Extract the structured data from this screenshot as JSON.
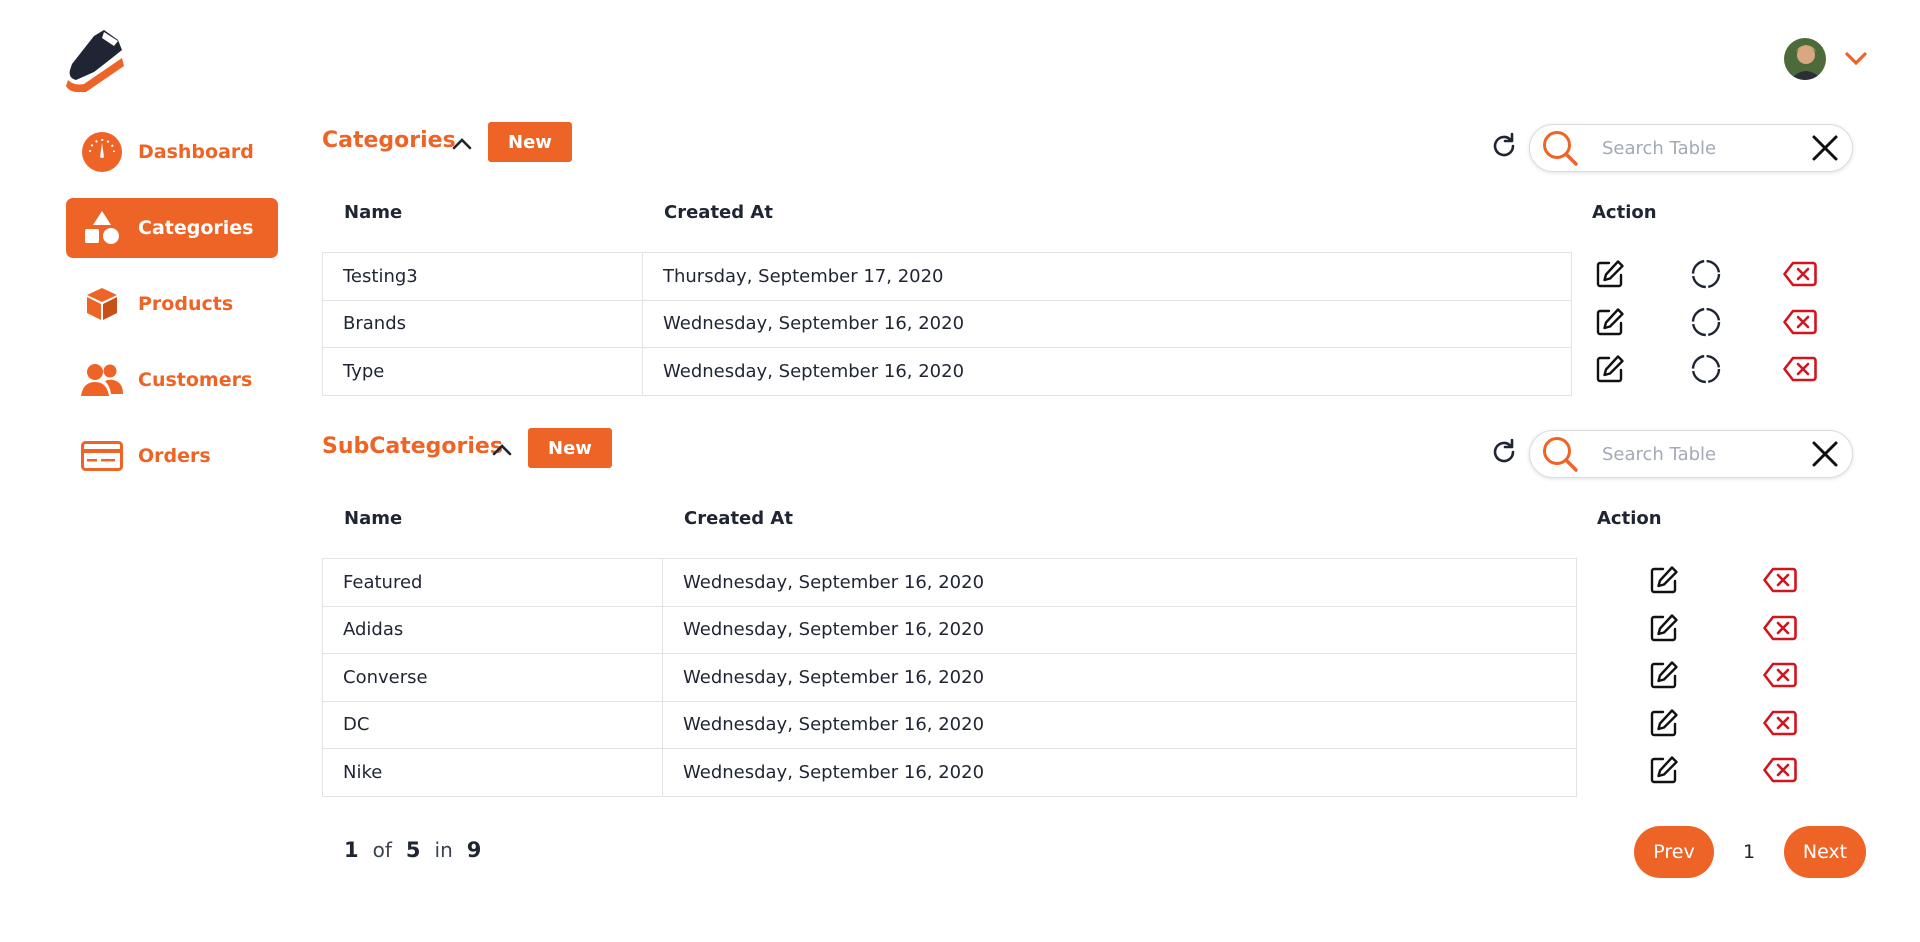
{
  "colors": {
    "accent": "#ee6427",
    "danger": "#d2141e",
    "text": "#1f2533"
  },
  "user": {
    "avatar_icon": "user-avatar",
    "menu_icon": "chevron-down-icon"
  },
  "sidebar": {
    "items": [
      {
        "label": "Dashboard",
        "icon": "gauge-icon",
        "active": false
      },
      {
        "label": "Categories",
        "icon": "shapes-icon",
        "active": true
      },
      {
        "label": "Products",
        "icon": "box-icon",
        "active": false
      },
      {
        "label": "Customers",
        "icon": "users-icon",
        "active": false
      },
      {
        "label": "Orders",
        "icon": "credit-card-icon",
        "active": false
      }
    ]
  },
  "categories": {
    "title": "Categories",
    "new_label": "New",
    "search_placeholder": "Search Table",
    "columns": {
      "name": "Name",
      "created": "Created At",
      "action": "Action"
    },
    "rows": [
      {
        "name": "Testing3",
        "created": "Thursday, September 17, 2020"
      },
      {
        "name": "Brands",
        "created": "Wednesday, September 16, 2020"
      },
      {
        "name": "Type",
        "created": "Wednesday, September 16, 2020"
      }
    ]
  },
  "subcategories": {
    "title": "SubCategories",
    "new_label": "New",
    "search_placeholder": "Search Table",
    "columns": {
      "name": "Name",
      "created": "Created At",
      "action": "Action"
    },
    "rows": [
      {
        "name": "Featured",
        "created": "Wednesday, September 16, 2020"
      },
      {
        "name": "Adidas",
        "created": "Wednesday, September 16, 2020"
      },
      {
        "name": "Converse",
        "created": "Wednesday, September 16, 2020"
      },
      {
        "name": "DC",
        "created": "Wednesday, September 16, 2020"
      },
      {
        "name": "Nike",
        "created": "Wednesday, September 16, 2020"
      }
    ]
  },
  "pagination": {
    "current": "1",
    "of_word": "of",
    "total_pages": "5",
    "in_word": "in",
    "total_items": "9",
    "prev_label": "Prev",
    "page": "1",
    "next_label": "Next"
  }
}
